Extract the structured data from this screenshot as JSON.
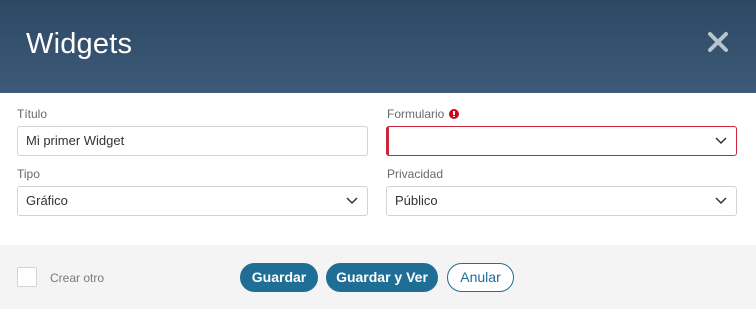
{
  "modal": {
    "title": "Widgets"
  },
  "form": {
    "titulo": {
      "label": "Título",
      "value": "Mi primer Widget"
    },
    "formulario": {
      "label": "Formulario",
      "value": "",
      "status": "error"
    },
    "tipo": {
      "label": "Tipo",
      "value": "Gráfico"
    },
    "privacidad": {
      "label": "Privacidad",
      "value": "Público"
    }
  },
  "footer": {
    "crear_otro_label": "Crear otro",
    "crear_otro_checked": false,
    "guardar_label": "Guardar",
    "guardar_y_ver_label": "Guardar y Ver",
    "anular_label": "Anular"
  },
  "icons": {
    "close": "close-icon",
    "error": "error-icon",
    "chevron": "chevron-down-icon"
  },
  "colors": {
    "header": "#34506d",
    "primary": "#1f6e95",
    "error": "#c8283c",
    "footer_bg": "#f4f4f4"
  }
}
